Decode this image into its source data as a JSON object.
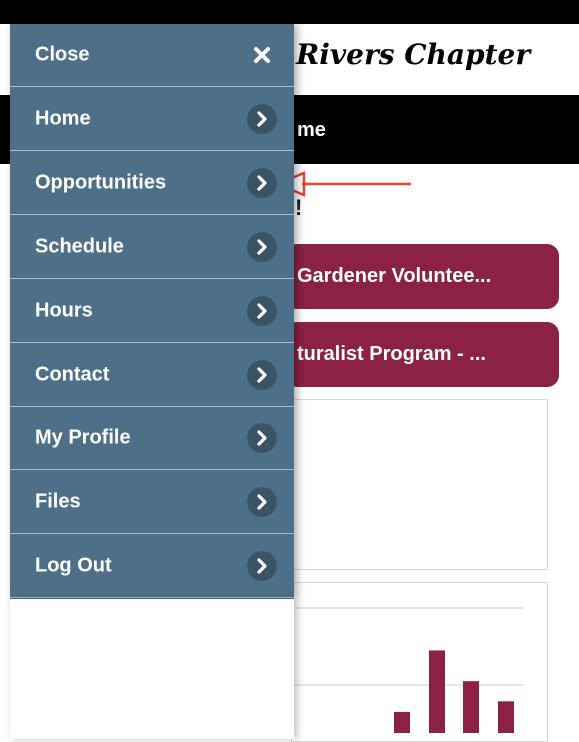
{
  "header": {
    "title": "Rivers Chapter"
  },
  "nav": {
    "label": "me"
  },
  "content": {
    "exclaim": "!",
    "pill1": "Gardener Voluntee...",
    "pill2": "turalist Program - ..."
  },
  "menu": {
    "items": [
      {
        "label": "Close",
        "icon": "close-icon"
      },
      {
        "label": "Home",
        "icon": "chevron-right-icon"
      },
      {
        "label": "Opportunities",
        "icon": "chevron-right-icon"
      },
      {
        "label": "Schedule",
        "icon": "chevron-right-icon"
      },
      {
        "label": "Hours",
        "icon": "chevron-right-icon"
      },
      {
        "label": "Contact",
        "icon": "chevron-right-icon"
      },
      {
        "label": "My Profile",
        "icon": "chevron-right-icon"
      },
      {
        "label": "Files",
        "icon": "chevron-right-icon"
      },
      {
        "label": "Log Out",
        "icon": "chevron-right-icon"
      }
    ]
  },
  "colors": {
    "menu_bg": "#4d7088",
    "icon_bg": "#3a5466",
    "accent": "#8c2146",
    "arrow": "#e8432f"
  },
  "chart_data": {
    "type": "bar",
    "values": [
      0.22,
      0.86,
      0.54,
      0.33
    ]
  }
}
